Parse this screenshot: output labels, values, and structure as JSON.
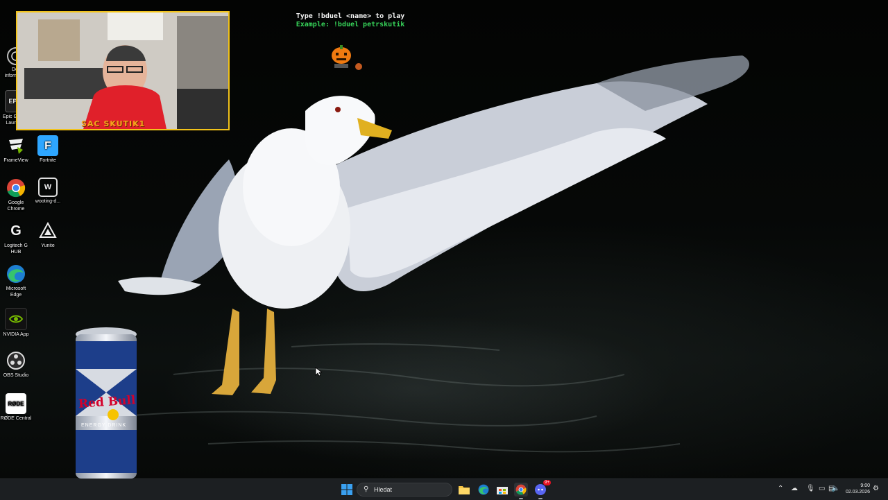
{
  "desktop_icons": [
    {
      "id": "icon-dell",
      "label": "Dell informac...",
      "icon": "dell-icon",
      "color": "#0076ce"
    },
    {
      "id": "icon-epic",
      "label": "Epic Games Launcher",
      "icon": "epic-games-icon",
      "color": "#2a2a2a"
    },
    {
      "id": "icon-frameview",
      "label": "FrameView",
      "icon": "frameview-icon",
      "color": "#76b900"
    },
    {
      "id": "icon-fortnite",
      "label": "Fortnite",
      "icon": "fortnite-icon",
      "color": "#2ea6ff"
    },
    {
      "id": "icon-chrome",
      "label": "Google Chrome",
      "icon": "chrome-icon",
      "color": "#db4437"
    },
    {
      "id": "icon-wooting",
      "label": "wooting-d...",
      "icon": "wooting-icon",
      "color": "#ffffff"
    },
    {
      "id": "icon-logitech",
      "label": "Logitech G HUB",
      "icon": "logitech-icon",
      "color": "#ffffff"
    },
    {
      "id": "icon-yunite",
      "label": "Yunite",
      "icon": "yunite-icon",
      "color": "#ffffff"
    },
    {
      "id": "icon-edge",
      "label": "Microsoft Edge",
      "icon": "edge-icon",
      "color": "#1fa9a0"
    },
    {
      "id": "icon-nvidia",
      "label": "NVIDIA App",
      "icon": "nvidia-icon",
      "color": "#76b900"
    },
    {
      "id": "icon-obs",
      "label": "OBS Studio",
      "icon": "obs-icon",
      "color": "#ffffff"
    },
    {
      "id": "icon-rode",
      "label": "RØDE Central",
      "icon": "rode-icon",
      "color": "#ffffff"
    }
  ],
  "rode_logo_text": "RØDE",
  "webcam": {
    "name_overlay": "SAC SKUTIK1",
    "border_color": "#f2c31a"
  },
  "bot_overlay": {
    "line1": "Type !bduel <name> to play",
    "line2": "Example: !bduel petrskutik"
  },
  "can_overlay": {
    "brand": "Red Bull",
    "sub": "ENERGY DRINK"
  },
  "taskbar": {
    "start_icon": "windows-start-icon",
    "search_placeholder": "Hledat",
    "pinned": [
      "file-explorer-icon",
      "edge-icon",
      "store-icon",
      "chrome-icon",
      "discord-icon"
    ],
    "discord_badge": "9+",
    "clock_time": "9:00",
    "clock_date": "02.03.2026",
    "tray_icons": [
      "chevron-up-icon",
      "cloud-icon",
      "microphone-icon",
      "battery-icon",
      "network-icon",
      "volume-icon",
      "notification-icon"
    ]
  }
}
